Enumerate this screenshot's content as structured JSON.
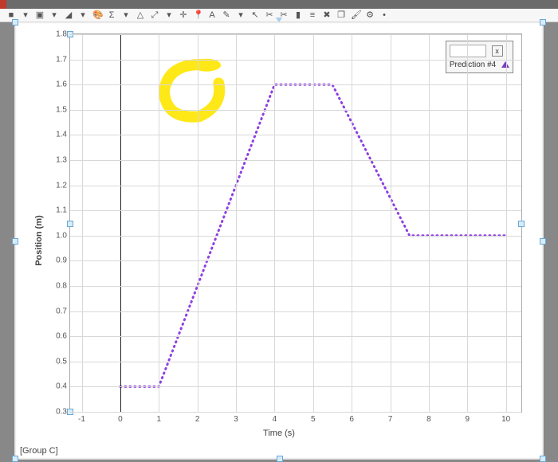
{
  "toolbar": {
    "icons": [
      "square-icon",
      "dropdown-arrow-icon",
      "square-dotted-icon",
      "dropdown-arrow-icon",
      "triangle-ruler-icon",
      "dropdown-arrow-icon",
      "palette-icon",
      "sigma-icon",
      "dropdown-arrow-icon",
      "warning-icon",
      "fit-icon",
      "dropdown-arrow-icon",
      "crosshair-icon",
      "pushpin-red-icon",
      "text-a-icon",
      "pencil-icon",
      "dropdown-arrow-icon",
      "cursor-icon",
      "scissors-icon",
      "scissors-icon",
      "bar-chart-icon",
      "align-icon",
      "delete-x-icon",
      "layers-icon",
      "paint-icon",
      "gear-icon",
      "dot-icon"
    ]
  },
  "legend": {
    "close_label": "x",
    "series_label": "Prediction #4"
  },
  "bottom_label": "[Group C]",
  "chart_data": {
    "type": "line",
    "title": "",
    "xlabel": "Time (s)",
    "ylabel": "Position (m)",
    "xlim": [
      -1.3,
      10.4
    ],
    "ylim": [
      0.3,
      1.8
    ],
    "x_ticks": [
      -1,
      0,
      1,
      2,
      3,
      4,
      5,
      6,
      7,
      8,
      9,
      10
    ],
    "y_ticks": [
      0.3,
      0.4,
      0.5,
      0.6,
      0.7,
      0.8,
      0.9,
      1.0,
      1.1,
      1.2,
      1.3,
      1.4,
      1.5,
      1.6,
      1.7,
      1.8
    ],
    "series": [
      {
        "name": "Prediction #4",
        "color": "#8e3fe0",
        "x": [
          0,
          1,
          4,
          5.5,
          7.5,
          10
        ],
        "y": [
          0.4,
          0.4,
          1.6,
          1.6,
          1.0,
          1.0
        ]
      }
    ],
    "highlight_annotation": {
      "shape": "freehand-circle",
      "cx": 1.8,
      "cy": 1.6,
      "color": "#ffe600"
    }
  }
}
